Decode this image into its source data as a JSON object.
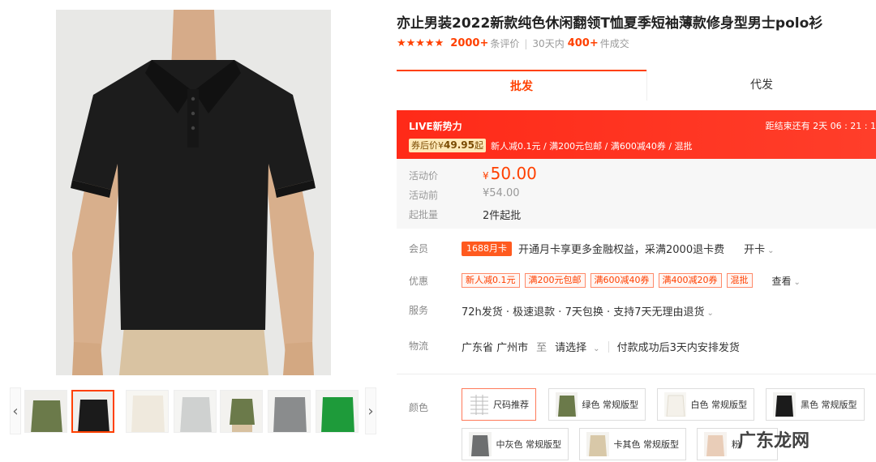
{
  "product": {
    "title": "亦止男装2022新款纯色休闲翻领T恤夏季短袖薄款修身型男士polo衫",
    "stars": "★★★★★",
    "reviews_count": "2000+",
    "reviews_label": "条评价",
    "sold_prefix": "30天内",
    "sold_count": "400+",
    "sold_suffix": "件成交",
    "shirt_color": "#1b1b1b",
    "skin_color": "#d9b08e",
    "pants_color": "#d8c1a0"
  },
  "tabs": [
    {
      "label": "批发",
      "active": true
    },
    {
      "label": "代发",
      "active": false
    }
  ],
  "promo": {
    "title": "LIVE新势力",
    "timer": "距结束还有 2天 06 : 21 : 1",
    "coupon_prefix": "券后价¥",
    "coupon_price": "49.95",
    "coupon_suffix": "起",
    "coupon_desc": "新人减0.1元 / 满200元包邮 / 满600减40券 / 混批"
  },
  "price": {
    "active_label": "活动价",
    "active_currency": "¥",
    "active_value": "50.00",
    "before_label": "活动前",
    "before_value": "¥54.00",
    "moq_label": "起批量",
    "moq_value": "2件起批"
  },
  "member": {
    "label": "会员",
    "tag": "1688月卡",
    "text": "开通月卡享更多金融权益，采满2000退卡费",
    "action": "开卡"
  },
  "discount": {
    "label": "优惠",
    "tags": [
      "新人减0.1元",
      "满200元包邮",
      "满600减40券",
      "满400减20券",
      "混批"
    ],
    "more": "查看"
  },
  "service": {
    "label": "服务",
    "text": "72h发货 · 极速退款 · 7天包换 · 支持7天无理由退货"
  },
  "logistics": {
    "label": "物流",
    "from": "广东省 广州市",
    "to": "至",
    "select": "请选择",
    "note": "付款成功后3天内安排发货"
  },
  "color": {
    "label": "颜色",
    "options": [
      {
        "name": "尺码推荐",
        "swatch": "#ffffff"
      },
      {
        "name": "绿色 常规版型",
        "swatch": "#6b7a4a"
      },
      {
        "name": "白色 常规版型",
        "swatch": "#f4f1ea"
      },
      {
        "name": "黑色 常规版型",
        "swatch": "#1b1b1b"
      },
      {
        "name": "中灰色 常规版型",
        "swatch": "#6d6f70"
      },
      {
        "name": "卡其色 常规版型",
        "swatch": "#d8c8a8"
      },
      {
        "name": "粉",
        "swatch": "#e9cdb8"
      }
    ]
  },
  "thumbs": [
    {
      "color": "#6b7a4a"
    },
    {
      "color": "#1b1b1b"
    },
    {
      "color": "#efe9dd"
    },
    {
      "color": "#cfd1d0"
    },
    {
      "color": "#6b7a4a"
    },
    {
      "color": "#8a8c8d"
    },
    {
      "color": "#1e9b3a"
    }
  ],
  "watermark": "广东龙网"
}
